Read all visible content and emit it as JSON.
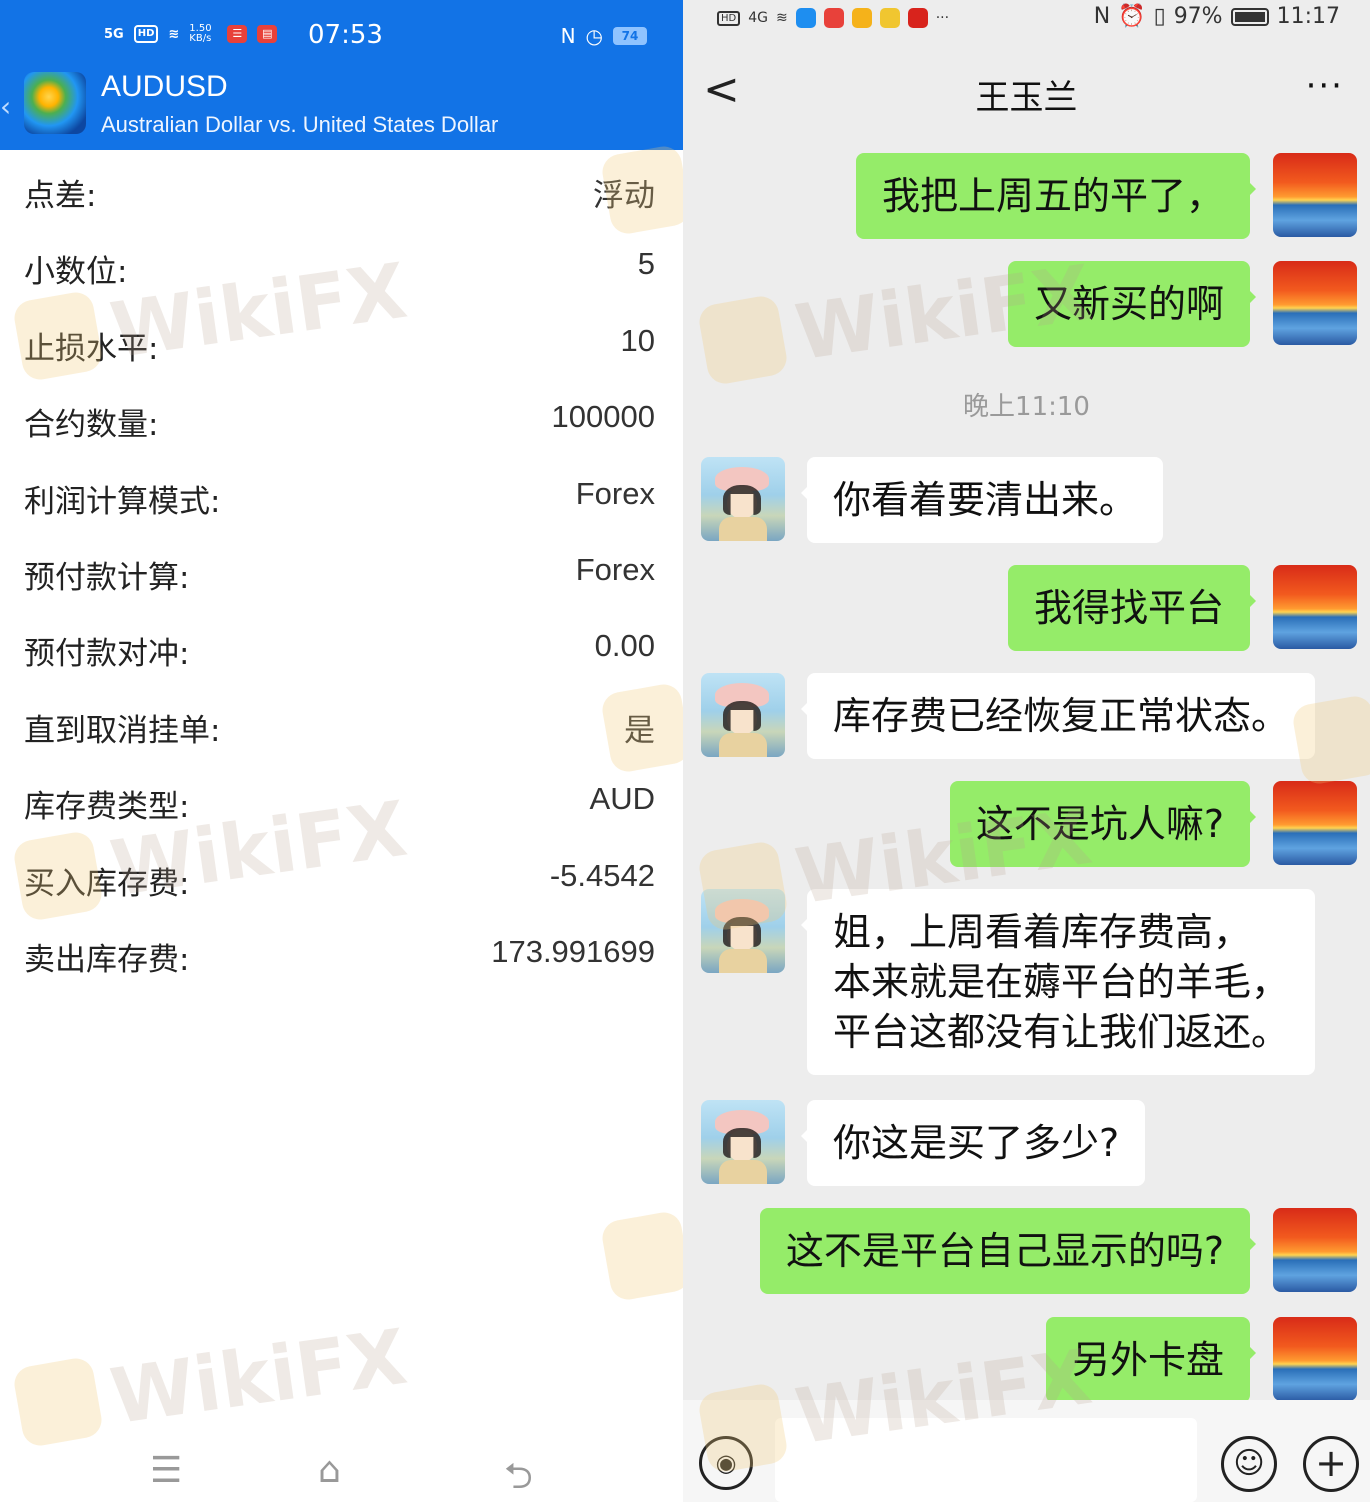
{
  "left": {
    "status_bar": {
      "signal": "5G",
      "hd": "HD",
      "net_speed": "1.50 KB/s",
      "time": "07:53",
      "battery": "74"
    },
    "header": {
      "symbol": "AUDUSD",
      "description": "Australian Dollar vs. United States Dollar"
    },
    "specs": [
      {
        "label": "点差:",
        "value": "浮动"
      },
      {
        "label": "小数位:",
        "value": "5"
      },
      {
        "label": "止损水平:",
        "value": "10"
      },
      {
        "label": "合约数量:",
        "value": "100000"
      },
      {
        "label": "利润计算模式:",
        "value": "Forex"
      },
      {
        "label": "预付款计算:",
        "value": "Forex"
      },
      {
        "label": "预付款对冲:",
        "value": "0.00"
      },
      {
        "label": "直到取消挂单:",
        "value": "是"
      },
      {
        "label": "库存费类型:",
        "value": "AUD"
      },
      {
        "label": "买入库存费:",
        "value": "-5.4542"
      },
      {
        "label": "卖出库存费:",
        "value": "173.991699"
      }
    ],
    "nav": {
      "menu": "☰",
      "home": "⌂",
      "back": "⮌"
    }
  },
  "right": {
    "status_bar": {
      "hd": "HD",
      "signal": "4G",
      "battery_percent": "97%",
      "time": "11:17"
    },
    "chat_title": "王玉兰",
    "more": "···",
    "back": "<",
    "time_separator": "晚上11:10",
    "messages": [
      {
        "from": "me",
        "text": "我把上周五的平了，"
      },
      {
        "from": "me",
        "text": "又新买的啊"
      },
      {
        "from": "other",
        "text": "你看着要清出来。"
      },
      {
        "from": "me",
        "text": "我得找平台"
      },
      {
        "from": "other",
        "text": "库存费已经恢复正常状态。"
      },
      {
        "from": "me",
        "text": "这不是坑人嘛?"
      },
      {
        "from": "other",
        "text": "姐，上周看着库存费高，\n本来就是在薅平台的羊毛，\n平台这都没有让我们返还。"
      },
      {
        "from": "other",
        "text": "你这是买了多少?"
      },
      {
        "from": "me",
        "text": "这不是平台自己显示的吗?"
      },
      {
        "from": "me",
        "text": "另外卡盘"
      }
    ],
    "input": {
      "voice": "◉",
      "emoji": "☺",
      "plus": "+"
    }
  },
  "watermark": "WikiFX",
  "colors": {
    "left_header": "#1273e6",
    "bubble_me": "#95ec69",
    "bubble_other": "#ffffff",
    "chat_bg": "#ededed"
  }
}
